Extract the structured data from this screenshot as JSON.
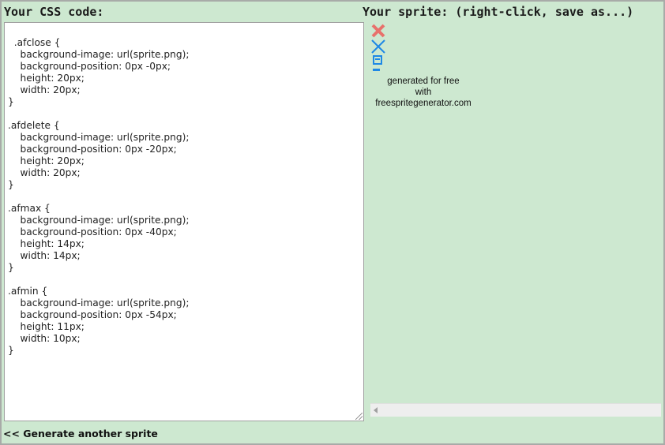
{
  "css_panel": {
    "heading": "Your CSS code:",
    "code": ".afclose {\n\tbackground-image: url(sprite.png);\n\tbackground-position: 0px -0px;\n\theight: 20px;\n\twidth: 20px;\n}\n\n.afdelete {\n\tbackground-image: url(sprite.png);\n\tbackground-position: 0px -20px;\n\theight: 20px;\n\twidth: 20px;\n}\n\n.afmax {\n\tbackground-image: url(sprite.png);\n\tbackground-position: 0px -40px;\n\theight: 14px;\n\twidth: 14px;\n}\n\n.afmin {\n\tbackground-image: url(sprite.png);\n\tbackground-position: 0px -54px;\n\theight: 11px;\n\twidth: 10px;\n}"
  },
  "sprite_panel": {
    "heading": "Your sprite: (right-click, save as...)",
    "icons": [
      {
        "name": "close-x-icon",
        "color": "#e8716b"
      },
      {
        "name": "delete-x-icon",
        "color": "#1e88e5"
      },
      {
        "name": "maximize-icon",
        "color": "#1e88e5"
      },
      {
        "name": "minimize-icon",
        "color": "#1e88e5"
      }
    ],
    "note_line1": "generated for free",
    "note_line2": "with",
    "note_line3": "freespritegenerator.com"
  },
  "footer": {
    "link_label": "<< Generate another sprite"
  },
  "colors": {
    "background": "#cde8d0",
    "border": "#a8aba8"
  }
}
